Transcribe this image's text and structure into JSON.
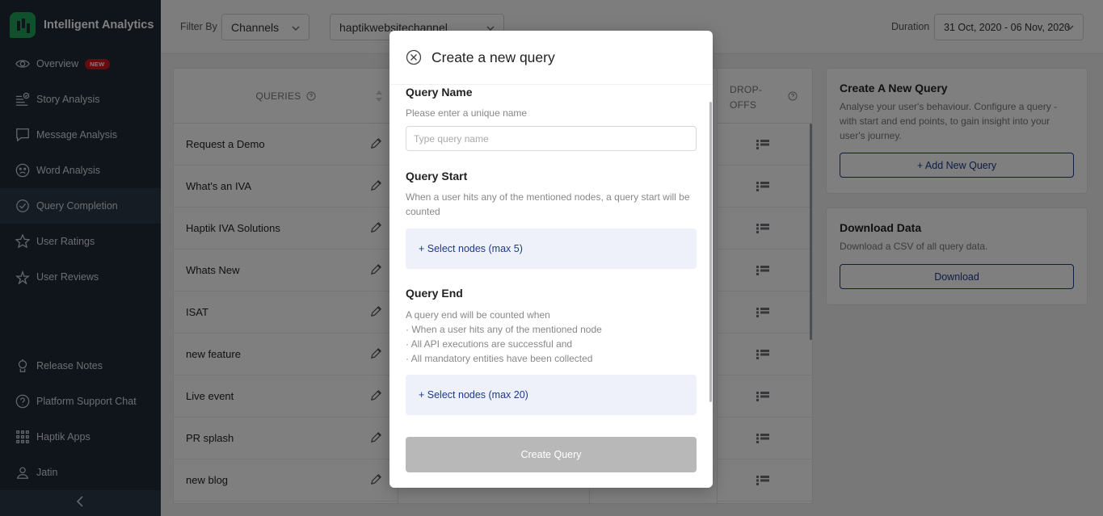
{
  "brand": {
    "title": "Intelligent Analytics"
  },
  "sidebar": {
    "items": [
      {
        "label": "Overview",
        "badge": "NEW",
        "icon": "eye-icon"
      },
      {
        "label": "Story Analysis",
        "icon": "story-icon"
      },
      {
        "label": "Message Analysis",
        "icon": "message-icon"
      },
      {
        "label": "Word Analysis",
        "icon": "word-icon"
      },
      {
        "label": "Query Completion",
        "icon": "query-check-icon",
        "active": true
      },
      {
        "label": "User Ratings",
        "icon": "star-icon"
      },
      {
        "label": "User Reviews",
        "icon": "review-icon"
      }
    ],
    "bottom_items": [
      {
        "label": "Release Notes",
        "icon": "release-icon"
      },
      {
        "label": "Platform Support Chat",
        "icon": "help-icon"
      },
      {
        "label": "Haptik Apps",
        "icon": "apps-grid-icon"
      },
      {
        "label": "Jatin",
        "icon": "user-icon"
      }
    ]
  },
  "topbar": {
    "filter_label": "Filter By",
    "filter_value": "Channels",
    "channel_value": "haptikwebsitechannel",
    "duration_label": "Duration",
    "duration_value": "31 Oct, 2020 - 06 Nov, 2020"
  },
  "table": {
    "queries_header": "QUERIES",
    "dropoffs_header_line1": "DROP-",
    "dropoffs_header_line2": "OFFS",
    "rows": [
      "Request a Demo",
      "What's an IVA",
      "Haptik IVA Solutions",
      "Whats New",
      "ISAT",
      "new feature",
      "Live event",
      "PR splash",
      "new blog"
    ]
  },
  "create_card": {
    "title": "Create A New Query",
    "description": "Analyse your user's behaviour. Configure a query - with start and end points, to gain insight into your user's journey.",
    "button": "+ Add New Query"
  },
  "download_card": {
    "title": "Download Data",
    "description": "Download a CSV of all query data.",
    "button": "Download"
  },
  "modal": {
    "title": "Create a new query",
    "name_title": "Query Name",
    "name_desc": "Please enter a unique name",
    "name_placeholder": "Type query name",
    "name_value": "",
    "start_title": "Query Start",
    "start_desc": "When a user hits any of the mentioned nodes, a query start will be counted",
    "start_select": "+ Select nodes (max 5)",
    "end_title": "Query End",
    "end_desc_intro": "A query end will be counted when",
    "end_desc_points": [
      "· When a user hits any of the mentioned node",
      "· All API executions are successful and",
      "· All mandatory entities have been collected"
    ],
    "end_select": "+ Select nodes (max 20)",
    "submit": "Create Query"
  }
}
